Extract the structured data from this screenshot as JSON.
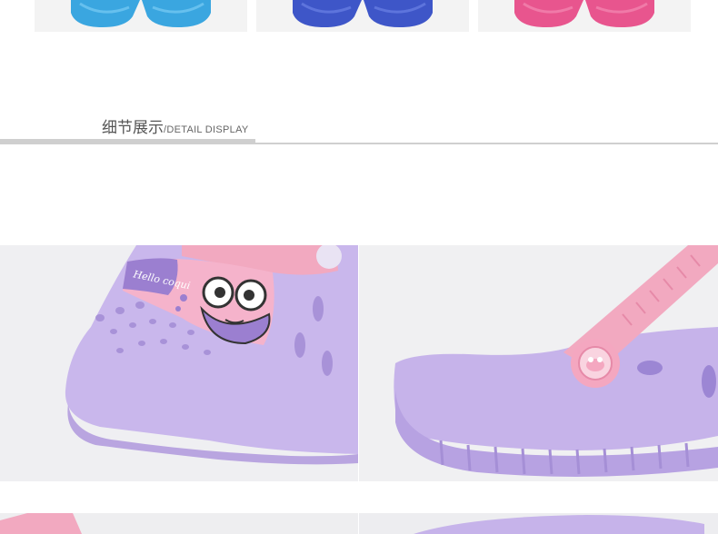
{
  "section": {
    "title_cn": "细节展示",
    "title_en": "/DETAIL DISPLAY"
  },
  "photos": {
    "detail_1_badge_text": "Hello coqui"
  },
  "colors": {
    "thumb_1": "#3aa6e0",
    "thumb_2": "#3e56c8",
    "thumb_3": "#e8558e",
    "shoe_body": "#c7b4ea",
    "strap": "#f2a9c0",
    "rule": "#cfcfcf"
  }
}
